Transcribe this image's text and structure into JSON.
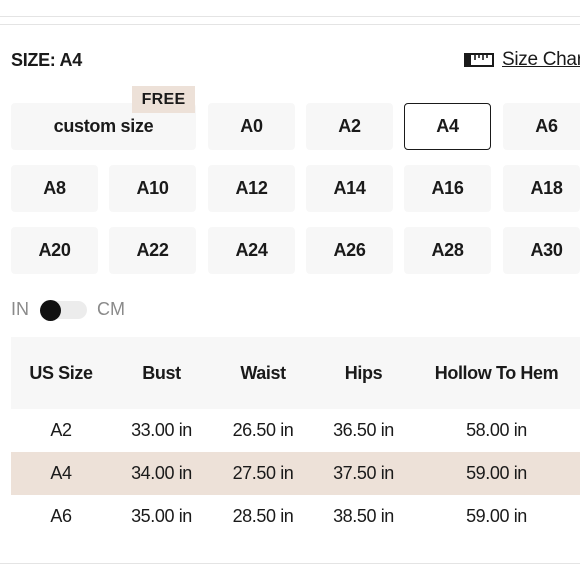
{
  "header": {
    "size_label": "SIZE: A4",
    "size_chart_label": "Size Chart",
    "size_chart_icon": "ruler-icon"
  },
  "sizes": {
    "selected": "A4",
    "free_badge": "FREE",
    "custom": "custom size",
    "row1": [
      "A0",
      "A2",
      "A4",
      "A6"
    ],
    "row2": [
      "A8",
      "A10",
      "A12",
      "A14",
      "A16",
      "A18"
    ],
    "row3": [
      "A20",
      "A22",
      "A24",
      "A26",
      "A28",
      "A30"
    ]
  },
  "units": {
    "left": "IN",
    "right": "CM",
    "active": "IN"
  },
  "table": {
    "headers": [
      "US Size",
      "Bust",
      "Waist",
      "Hips",
      "Hollow To Hem"
    ],
    "rows": [
      [
        "A2",
        "33.00 in",
        "26.50 in",
        "36.50 in",
        "58.00 in"
      ],
      [
        "A4",
        "34.00 in",
        "27.50 in",
        "37.50 in",
        "59.00 in"
      ],
      [
        "A6",
        "35.00 in",
        "28.50 in",
        "38.50 in",
        "59.00 in"
      ]
    ],
    "highlighted_row": 1
  },
  "colors": {
    "highlight": "#ede1d8",
    "button_bg": "#f7f7f7",
    "text": "#1a1a1a",
    "muted": "#8a8a8a"
  }
}
